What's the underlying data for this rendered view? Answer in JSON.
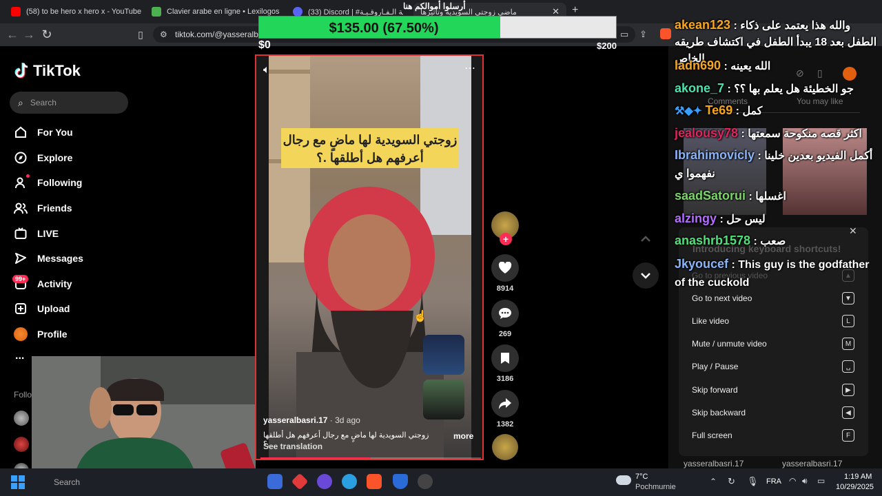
{
  "browser": {
    "tabs": [
      {
        "title": "(58) to be hero x hero x - YouTube",
        "favicon_color": "#ff0000"
      },
      {
        "title": "Clavier arabe en ligne • Lexilogos",
        "favicon_color": "#4caf50"
      },
      {
        "title": "(33) Discord | #نـقـاش-الـفـاروقـيـة | دولـة الـفـاروقـيـة",
        "favicon_color": "#5865f2"
      },
      {
        "title": "ماضي زوجتي السويدية وتأثيرها",
        "favicon_color": "#000000"
      }
    ],
    "new_tab": "+",
    "url": "tiktok.com/@yasseralbasri.17"
  },
  "tiktok": {
    "logo": "TikTok",
    "search_placeholder": "Search",
    "nav": [
      {
        "label": "For You",
        "icon": "home-icon"
      },
      {
        "label": "Explore",
        "icon": "compass-icon"
      },
      {
        "label": "Following",
        "icon": "following-icon"
      },
      {
        "label": "Friends",
        "icon": "friends-icon"
      },
      {
        "label": "LIVE",
        "icon": "live-icon"
      },
      {
        "label": "Messages",
        "icon": "messages-icon"
      },
      {
        "label": "Activity",
        "icon": "activity-icon"
      },
      {
        "label": "Upload",
        "icon": "upload-icon"
      },
      {
        "label": "Profile",
        "icon": "profile-icon"
      }
    ],
    "activity_badge": "99+",
    "more": "...",
    "following_header": "Follo",
    "video": {
      "caption": "زوجتي السويدية لها ماضٍ مع رجال أعرفهم هل أطلقها .؟",
      "author": "yasseralbasri.17",
      "date": " · 3d ago",
      "description": "زوجتي السويدية لها ماضٍ مع رجال أعرفهم هل أطلقها .؟",
      "see_translation": "See translation",
      "more": "more",
      "progress": 0.5
    },
    "actions": {
      "likes": "8914",
      "comments": "269",
      "saves": "3186",
      "shares": "1382"
    }
  },
  "donation": {
    "amount_text": "$135.00 (67.50%)",
    "min": "$0",
    "max": "$200",
    "fraction": 0.675,
    "note": "أرسلوا أموالكم هنا"
  },
  "side_panel": {
    "tabs": {
      "comments": "Comments",
      "you_may_like": "You may like"
    },
    "shortcuts_title": "Introducing keyboard shortcuts!",
    "shortcuts": [
      {
        "label": "Go to previous video",
        "key": "▲"
      },
      {
        "label": "Go to next video",
        "key": "▼"
      },
      {
        "label": "Like video",
        "key": "L"
      },
      {
        "label": "Mute / unmute video",
        "key": "M"
      },
      {
        "label": "Play / Pause",
        "key": "␣"
      },
      {
        "label": "Skip forward",
        "key": "▶"
      },
      {
        "label": "Skip backward",
        "key": "◀"
      },
      {
        "label": "Full screen",
        "key": "F"
      }
    ],
    "users": [
      "yasseralbasri.17",
      "yasseralbasri.17"
    ]
  },
  "chat": [
    {
      "user": "akean123",
      "color": "#f5a623",
      "text": "والله هذا يعتمد على ذكاء الطفل بعد 18 يبدأ الطفل في اكتشاف طريقه الخاص"
    },
    {
      "user": "ladn690",
      "color": "#f5a623",
      "text": "الله يعينه"
    },
    {
      "user": "akone_7",
      "color": "#4fe0b0",
      "text": "جو الخطيئة هل يعلم بها ؟؟"
    },
    {
      "user": "Te69",
      "color": "#f5a623",
      "text": "كمل"
    },
    {
      "user": "jealousy78",
      "color": "#e0245e",
      "text": "اكثر قصه منكوحة سمعتها"
    },
    {
      "user": "Ibrahimovicly",
      "color": "#8ab4f8",
      "text": "أكمل الفيديو بعدين خلينا نفهموا ي"
    },
    {
      "user": "saadSatorui",
      "color": "#7cd36b",
      "text": "اغسلها"
    },
    {
      "user": "alzingy",
      "color": "#b46cff",
      "text": "ليس حل"
    },
    {
      "user": "anashrb1578",
      "color": "#4fe07a",
      "text": "صعب"
    },
    {
      "user": "Jkyoucef",
      "color": "#8ab4f8",
      "text": "This guy is the godfather of the cuckold"
    }
  ],
  "taskbar": {
    "search": "Search",
    "weather_temp": "7°C",
    "weather_desc": "Pochmurnie",
    "lang": "FRA",
    "time": "1:19 AM",
    "date": "10/29/2025"
  }
}
